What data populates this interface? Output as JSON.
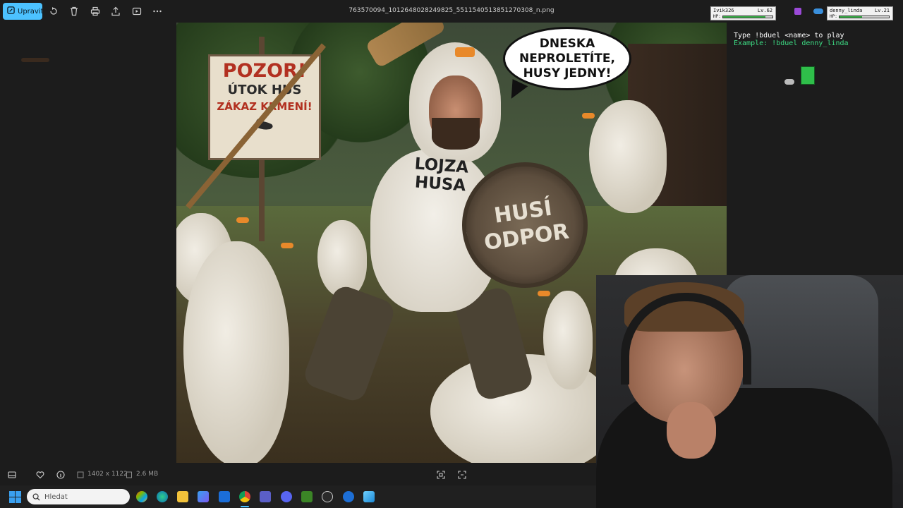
{
  "toolbar": {
    "edit_label": "Upravit",
    "filename": "763570094_1012648028249825_5511540513851270308_n.png",
    "icons": [
      "edit-icon",
      "rotate-icon",
      "delete-icon",
      "print-icon",
      "share-icon",
      "slideshow-icon",
      "more-icon"
    ]
  },
  "image": {
    "sign_line1": "POZOR!",
    "sign_line2": "ÚTOK HUS",
    "sign_line3": "ZÁKAZ KRMENÍ!",
    "bubble_line1": "DNESKA",
    "bubble_line2": "NEPROLETÍTE,",
    "bubble_line3": "HUSY JEDNY!",
    "shirt_line1": "LOJZA",
    "shirt_line2": "HUSA",
    "shield_line1": "HUSÍ",
    "shield_line2": "ODPOR"
  },
  "bottombar": {
    "dimensions": "1402 x 1122",
    "filesize": "2.6 MB"
  },
  "taskbar": {
    "search_placeholder": "Hledat"
  },
  "overlay": {
    "player1_name": "Ivik326",
    "player1_level": "Lv.62",
    "player1_hp": "HP:",
    "player1_hp_fraction": 0.85,
    "player2_name": "denny_linda",
    "player2_level": "Lv.21",
    "player2_hp": "HP:",
    "player2_hp_fraction": 0.45,
    "bot_line1": "Type !bduel <name> to play",
    "bot_line2": "Example: !bduel denny_linda"
  },
  "colors": {
    "accent": "#4cc2ff",
    "bot_text": "#ffffff",
    "bot_example": "#3ddc84"
  }
}
